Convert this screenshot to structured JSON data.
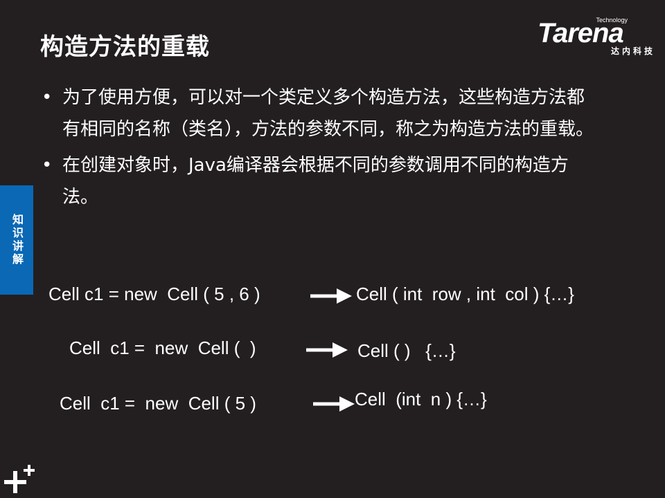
{
  "slide": {
    "title": "构造方法的重载",
    "side_tab": "知识讲解"
  },
  "logo": {
    "small_text": "Technology",
    "brand": "Tarena",
    "chinese": "达内科技"
  },
  "bullets": [
    {
      "text": "为了使用方便，可以对一个类定义多个构造方法，这些构造方法都有相同的名称（类名），方法的参数不同，称之为构造方法的重载。"
    },
    {
      "text": "在创建对象时，Java编译器会根据不同的参数调用不同的构造方法。"
    }
  ],
  "bullet_symbol": "•",
  "examples": [
    {
      "call": "Cell c1 = new  Cell ( 5 , 6 )",
      "constructor": "Cell ( int  row , int  col ) {…}"
    },
    {
      "call": "Cell  c1 =  new  Cell (  )",
      "constructor": "Cell ( )   {…}"
    },
    {
      "call": "Cell  c1 =  new  Cell ( 5 )",
      "constructor": "Cell  (int  n ) {…}"
    }
  ],
  "colors": {
    "background": "#231f20",
    "accent_blue": "#0a68b5",
    "text": "#ffffff"
  },
  "icons": {
    "arrow": "right-arrow-icon",
    "corner": "plus-icon"
  }
}
